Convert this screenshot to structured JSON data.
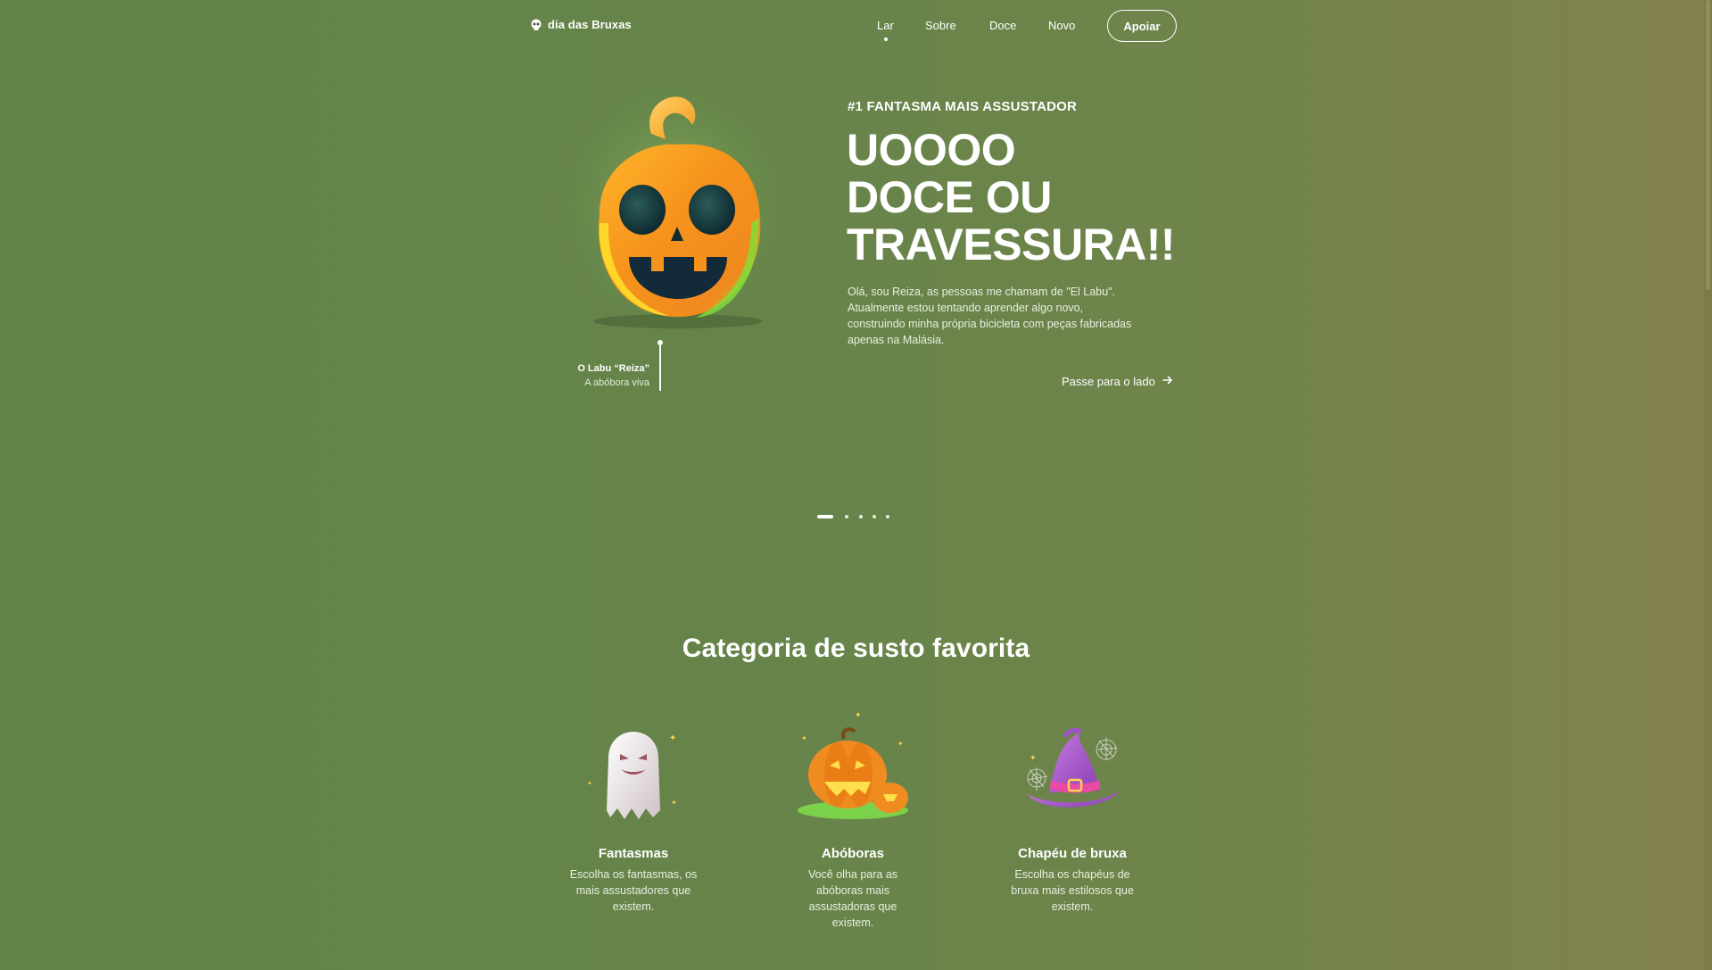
{
  "brand": {
    "name": "dia das Bruxas",
    "icon": "skull-icon"
  },
  "nav": {
    "items": [
      {
        "label": "Lar",
        "active": true
      },
      {
        "label": "Sobre",
        "active": false
      },
      {
        "label": "Doce",
        "active": false
      },
      {
        "label": "Novo",
        "active": false
      }
    ],
    "cta_label": "Apoiar"
  },
  "hero": {
    "eyebrow": "#1 FANTASMA MAIS ASSUSTADOR",
    "headline": [
      "UOOOO",
      "DOCE OU",
      "TRAVESSURA!!"
    ],
    "intro": "Olá, sou Reiza, as pessoas me chamam de \"El Labu\". Atualmente estou tentando aprender algo novo, construindo minha própria bicicleta com peças fabricadas apenas na Malásia.",
    "swipe_label": "Passe para o lado",
    "swipe_icon": "arrow-right-icon",
    "caption": {
      "name": "O Labu “Reiza”",
      "subtitle": "A abóbora viva"
    },
    "slides_total": 5,
    "slide_active": 1
  },
  "categories": {
    "title": "Categoria de susto favorita",
    "items": [
      {
        "title": "Fantasmas",
        "description": "Escolha os fantasmas, os mais assustadores que existem.",
        "icon": "ghost-icon"
      },
      {
        "title": "Abóboras",
        "description": "Você olha para as abóboras mais assustadoras que existem.",
        "icon": "pumpkin-icon"
      },
      {
        "title": "Chapéu de bruxa",
        "description": "Escolha os chapéus de bruxa mais estilosos que existem.",
        "icon": "witch-hat-icon"
      }
    ]
  },
  "colors": {
    "background_left": "#63834a",
    "background_right": "#83824d",
    "pumpkin_orange": "#f39a1c",
    "pumpkin_yellow": "#ffd21a",
    "glow_green": "#7ce23a"
  }
}
